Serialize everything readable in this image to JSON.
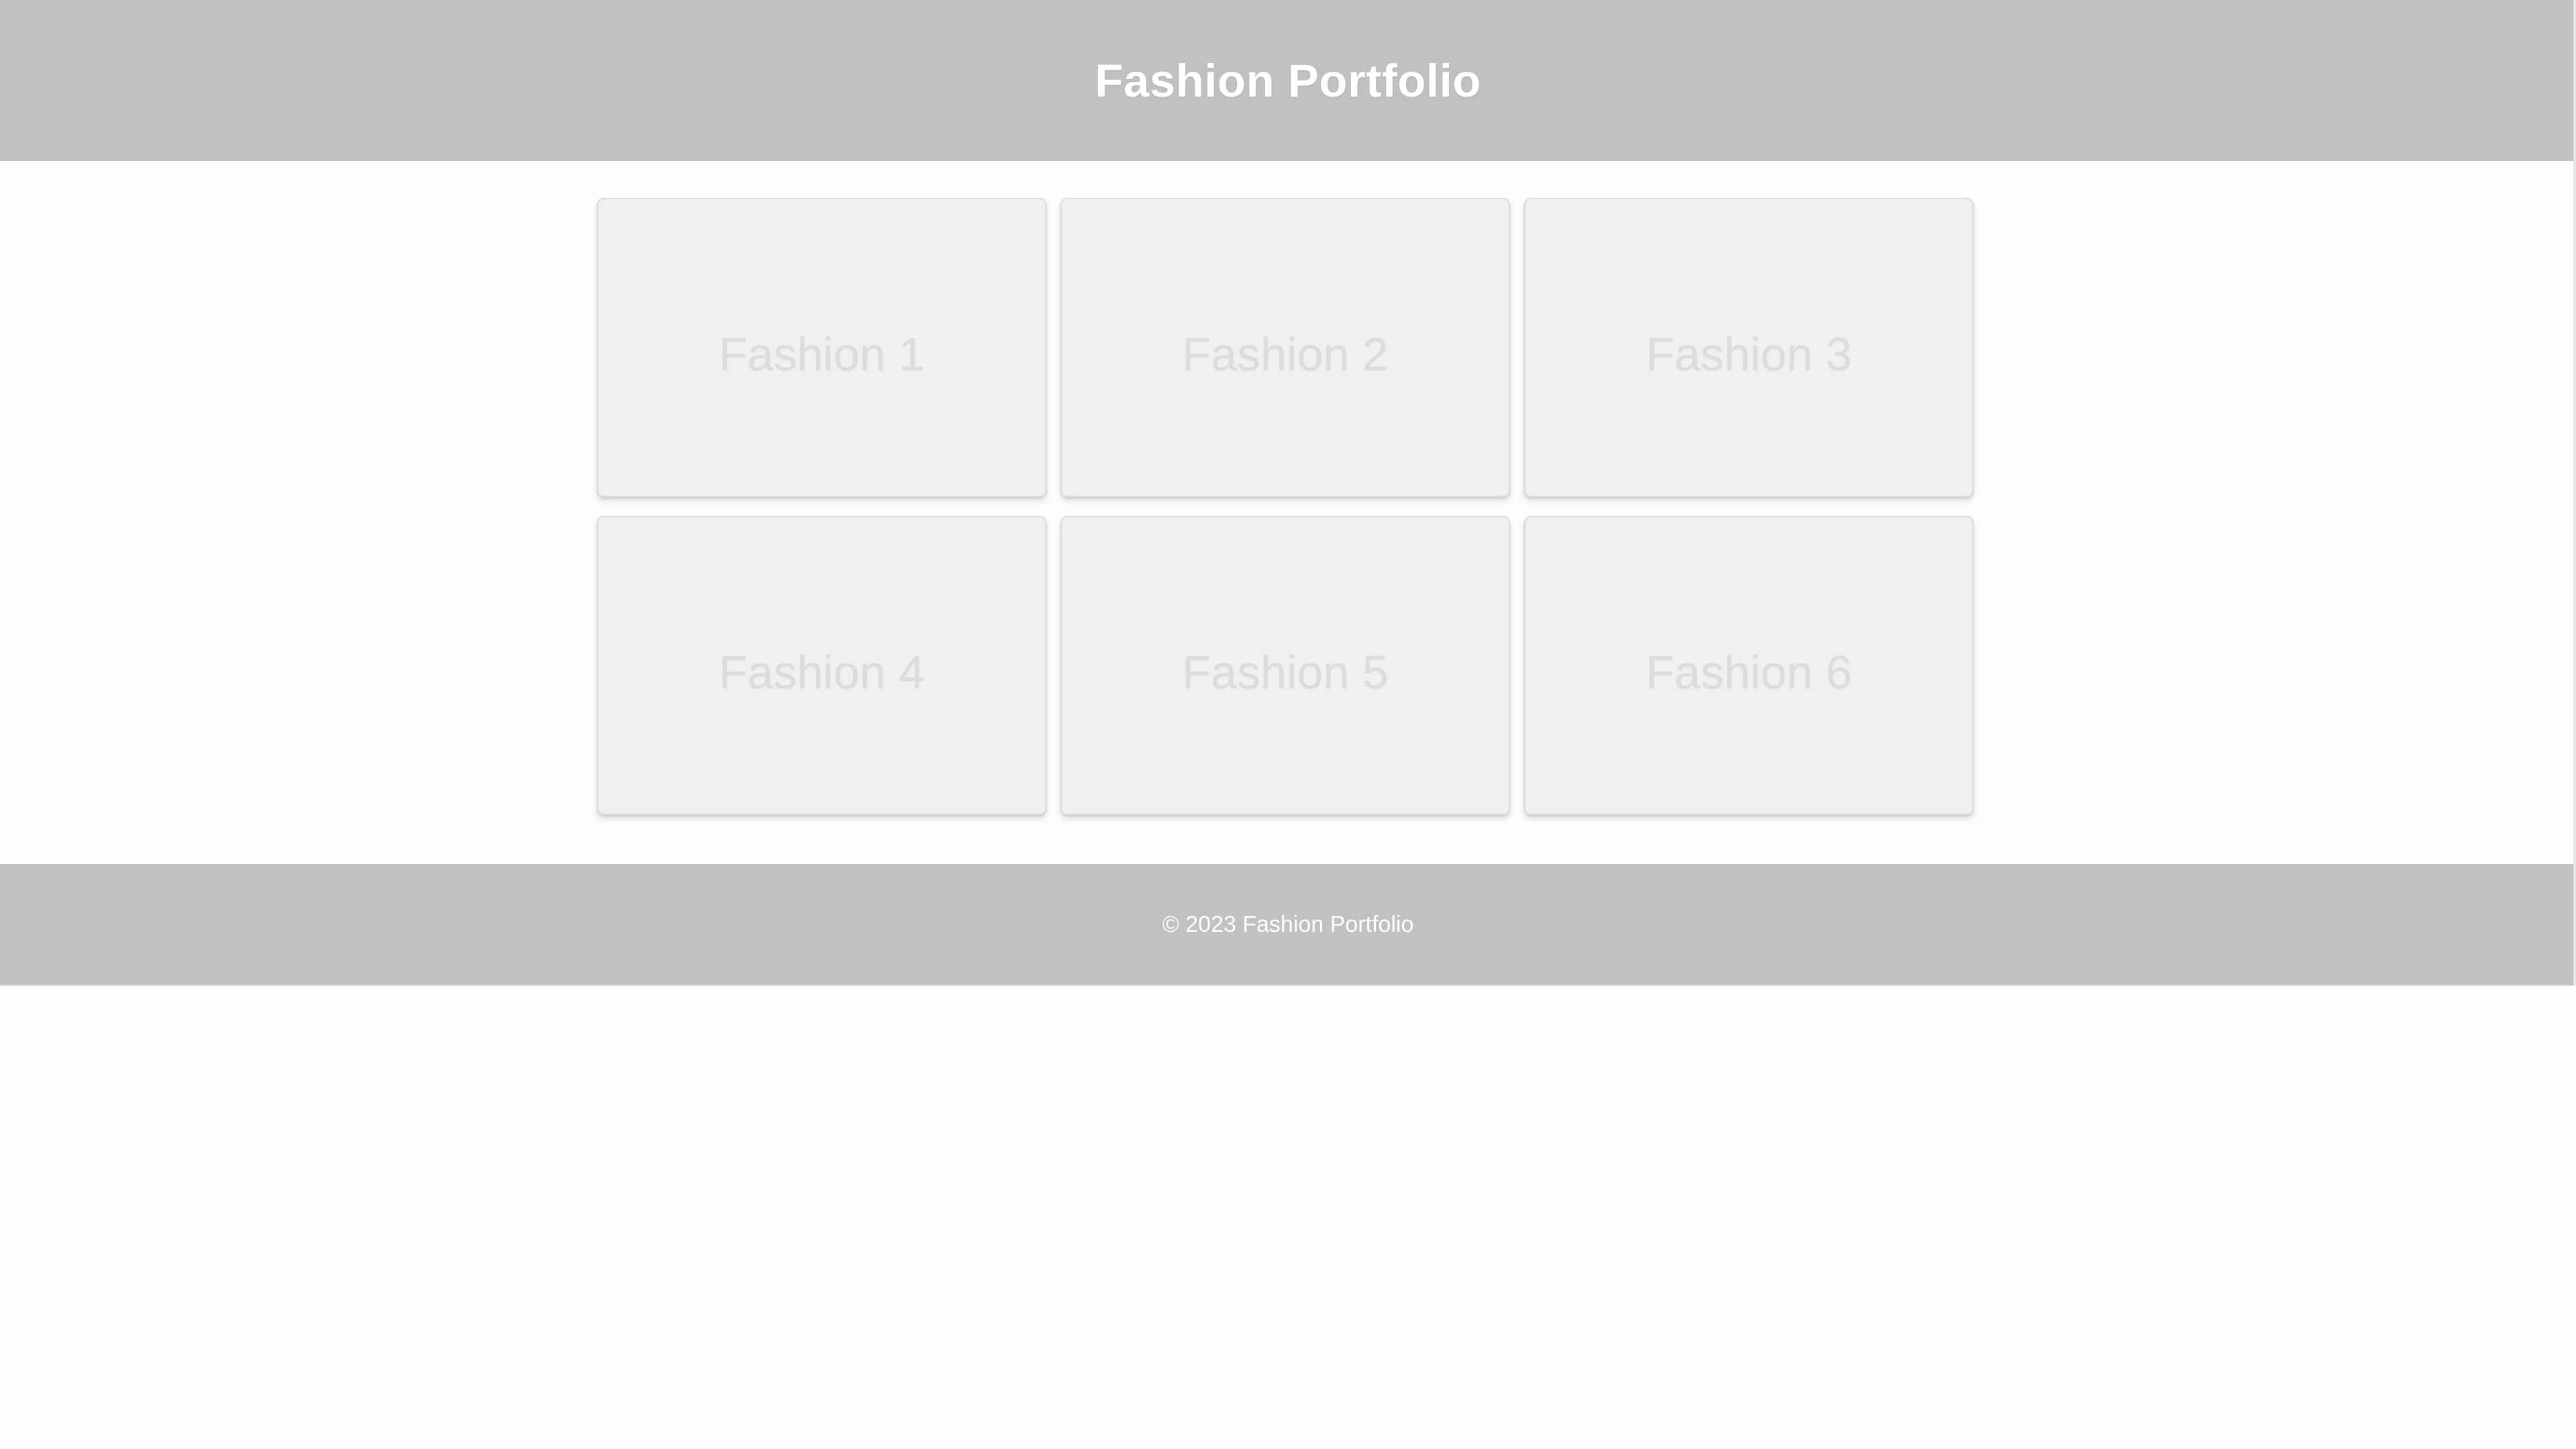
{
  "header": {
    "title": "Fashion Portfolio"
  },
  "gallery": {
    "items": [
      {
        "label": "Fashion 1"
      },
      {
        "label": "Fashion 2"
      },
      {
        "label": "Fashion 3"
      },
      {
        "label": "Fashion 4"
      },
      {
        "label": "Fashion 5"
      },
      {
        "label": "Fashion 6"
      }
    ]
  },
  "footer": {
    "text": "© 2023 Fashion Portfolio"
  },
  "colors": {
    "header_bg": "#c1c1c1",
    "footer_bg": "#c1c1c1",
    "card_bg": "#f0f0f0",
    "page_bg": "#fdfdfd"
  }
}
